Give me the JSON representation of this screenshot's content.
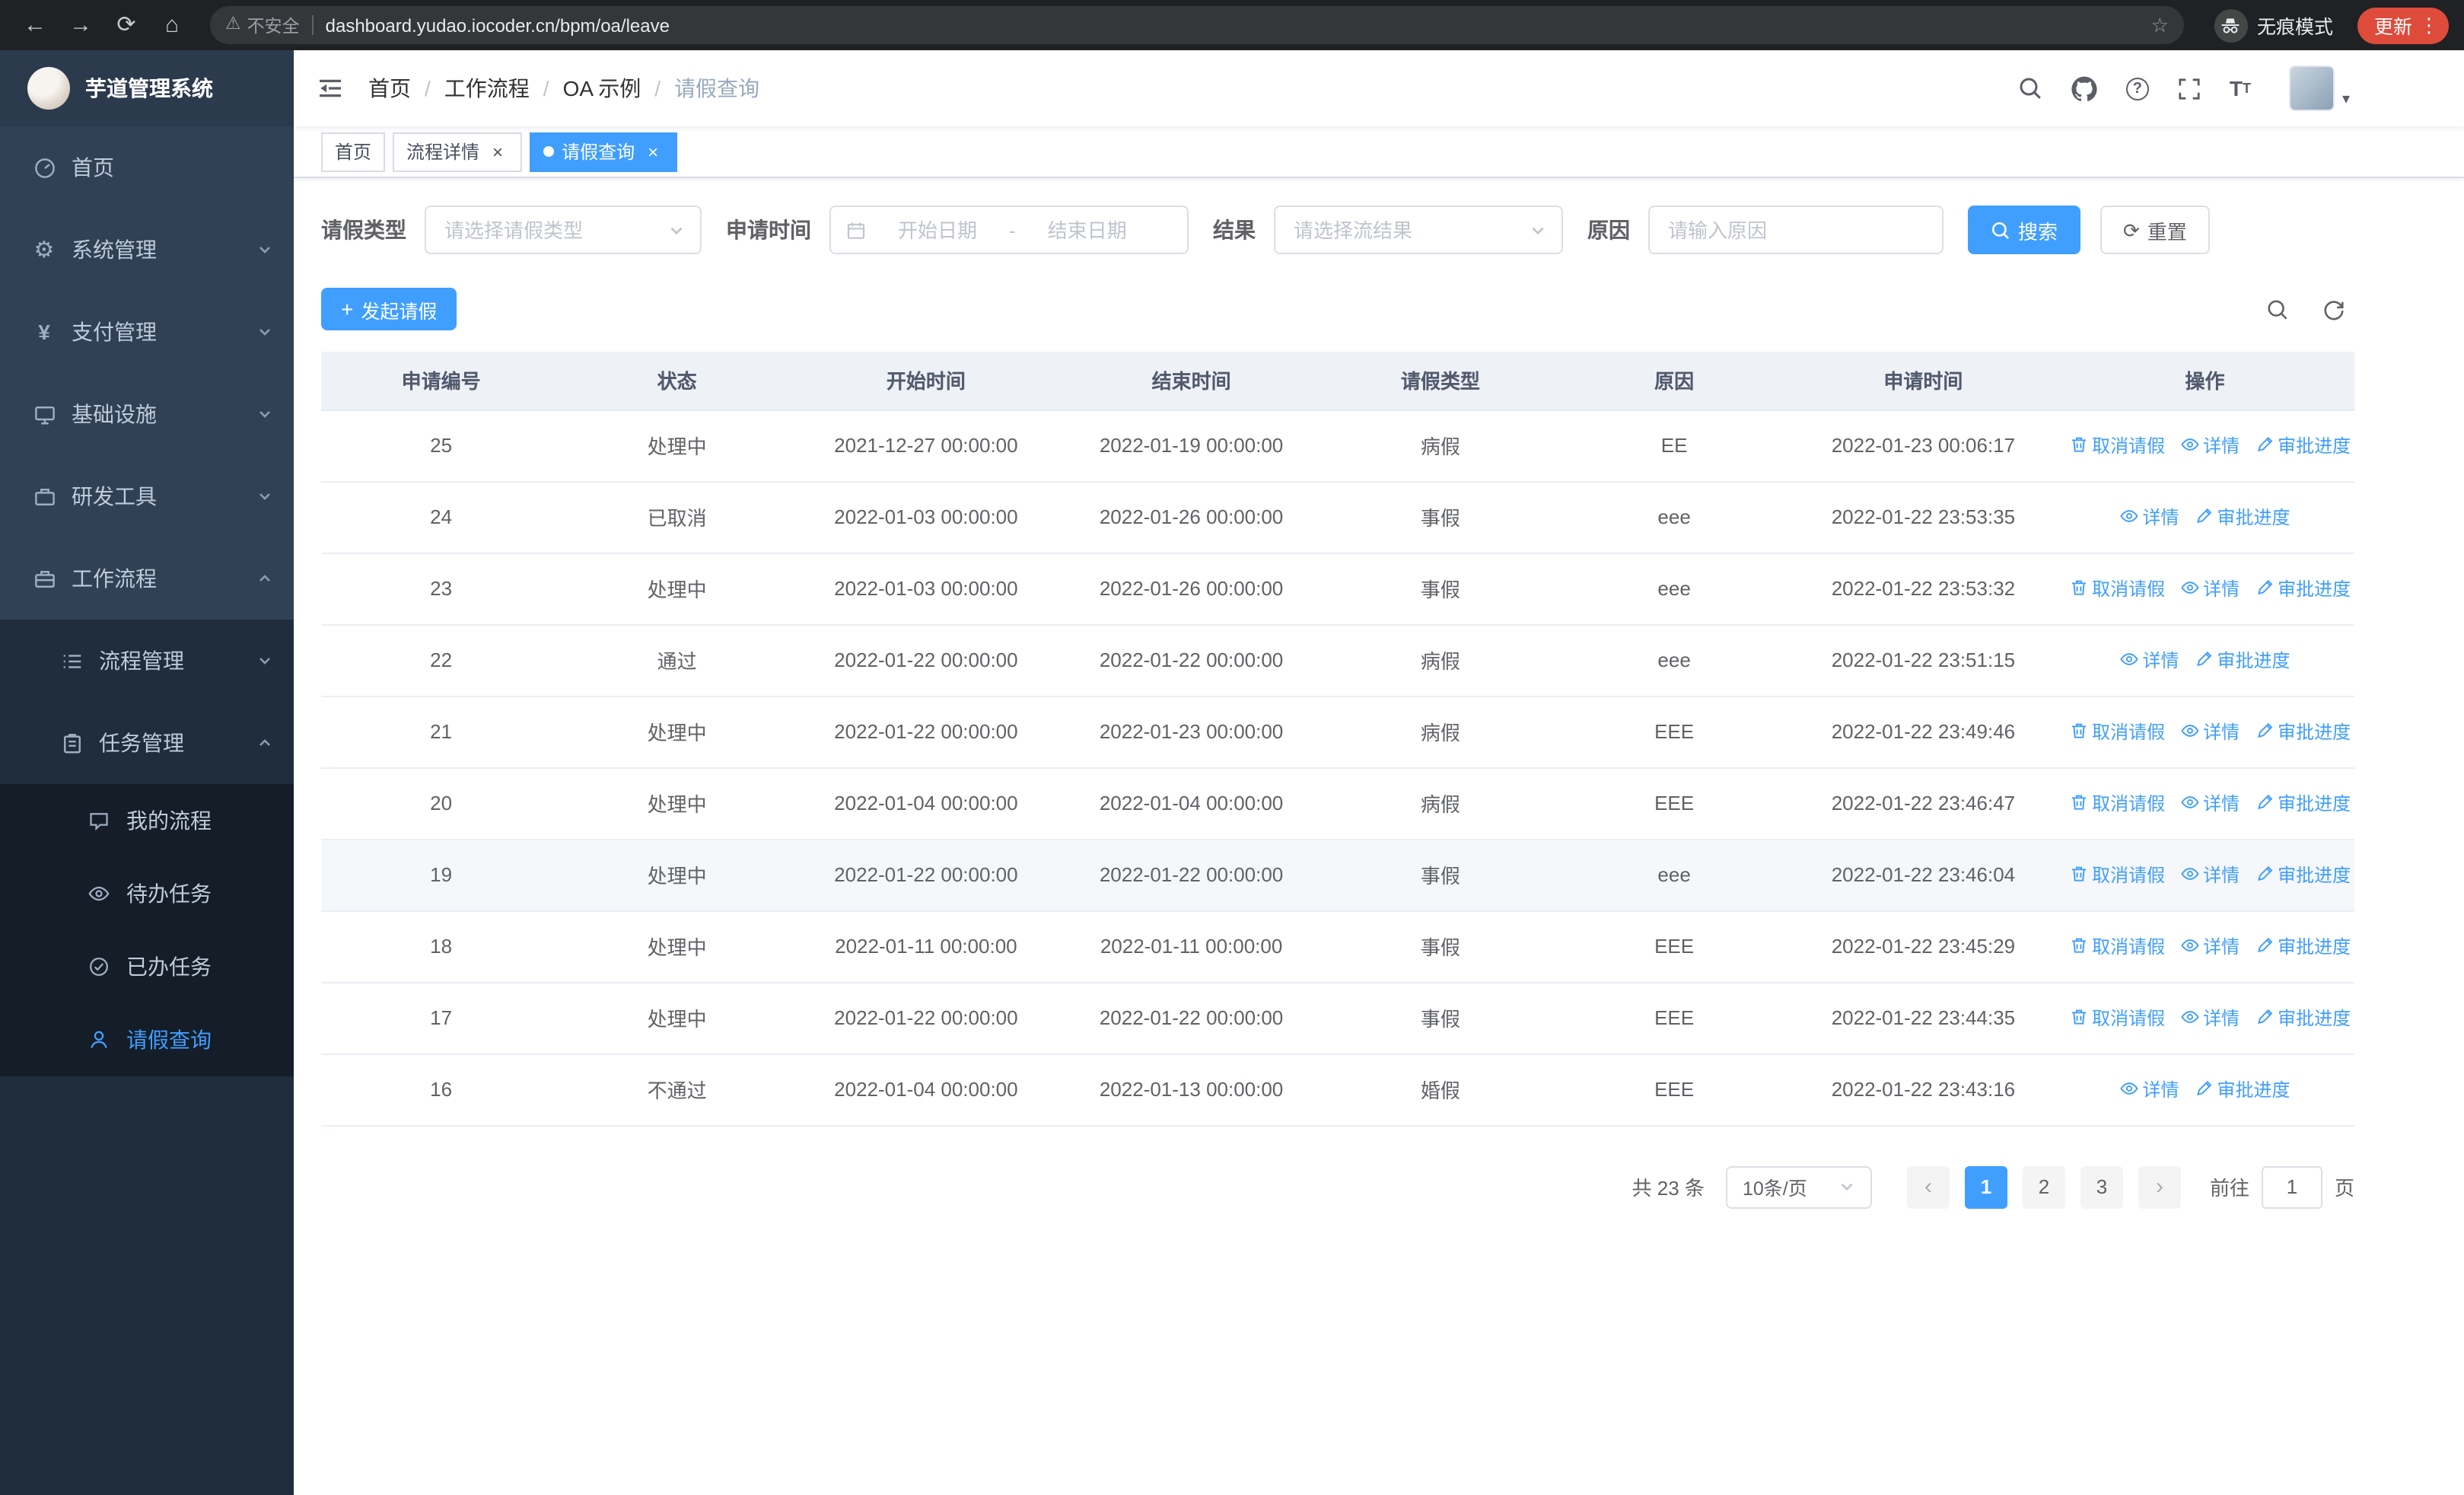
{
  "browser": {
    "security_label": "不安全",
    "url": "dashboard.yudao.iocoder.cn/bpm/oa/leave",
    "incognito_label": "无痕模式",
    "update_label": "更新"
  },
  "icons": {
    "back": "←",
    "forward": "→",
    "reload": "⟳",
    "home": "⌂",
    "warning": "⚠",
    "star": "☆",
    "dots": "⋮",
    "gear": "⚙",
    "yen": "¥",
    "question": "?",
    "plus": "+",
    "close": "×",
    "caret": "▾",
    "t_large": "T",
    "t_small": "T",
    "prev": "‹",
    "next": "›"
  },
  "sidebar": {
    "logo_title": "芋道管理系统",
    "menu": [
      {
        "label": "首页"
      },
      {
        "label": "系统管理"
      },
      {
        "label": "支付管理"
      },
      {
        "label": "基础设施"
      },
      {
        "label": "研发工具"
      },
      {
        "label": "工作流程"
      },
      {
        "label": "流程管理"
      },
      {
        "label": "任务管理"
      },
      {
        "label": "我的流程"
      },
      {
        "label": "待办任务"
      },
      {
        "label": "已办任务"
      },
      {
        "label": "请假查询"
      }
    ]
  },
  "header": {
    "breadcrumb": [
      "首页",
      "工作流程",
      "OA 示例",
      "请假查询"
    ]
  },
  "tabs": [
    {
      "label": "首页"
    },
    {
      "label": "流程详情"
    },
    {
      "label": "请假查询"
    }
  ],
  "filters": {
    "leave_type": {
      "label": "请假类型",
      "placeholder": "请选择请假类型"
    },
    "apply_time": {
      "label": "申请时间",
      "start_placeholder": "开始日期",
      "separator": "-",
      "end_placeholder": "结束日期"
    },
    "result": {
      "label": "结果",
      "placeholder": "请选择流结果"
    },
    "reason": {
      "label": "原因",
      "placeholder": "请输入原因"
    },
    "search_label": "搜索",
    "reset_label": "重置"
  },
  "toolbar": {
    "create_label": "发起请假"
  },
  "table": {
    "columns": [
      "申请编号",
      "状态",
      "开始时间",
      "结束时间",
      "请假类型",
      "原因",
      "申请时间",
      "操作"
    ],
    "op_labels": {
      "cancel": "取消请假",
      "detail": "详情",
      "progress": "审批进度"
    },
    "rows": [
      {
        "id": "25",
        "status": "处理中",
        "start": "2021-12-27 00:00:00",
        "end": "2022-01-19 00:00:00",
        "type": "病假",
        "reason": "EE",
        "apply_time": "2022-01-23 00:06:17",
        "ops": [
          "cancel",
          "detail",
          "progress"
        ],
        "highlighted": false
      },
      {
        "id": "24",
        "status": "已取消",
        "start": "2022-01-03 00:00:00",
        "end": "2022-01-26 00:00:00",
        "type": "事假",
        "reason": "eee",
        "apply_time": "2022-01-22 23:53:35",
        "ops": [
          "detail",
          "progress"
        ],
        "highlighted": false
      },
      {
        "id": "23",
        "status": "处理中",
        "start": "2022-01-03 00:00:00",
        "end": "2022-01-26 00:00:00",
        "type": "事假",
        "reason": "eee",
        "apply_time": "2022-01-22 23:53:32",
        "ops": [
          "cancel",
          "detail",
          "progress"
        ],
        "highlighted": false
      },
      {
        "id": "22",
        "status": "通过",
        "start": "2022-01-22 00:00:00",
        "end": "2022-01-22 00:00:00",
        "type": "病假",
        "reason": "eee",
        "apply_time": "2022-01-22 23:51:15",
        "ops": [
          "detail",
          "progress"
        ],
        "highlighted": false
      },
      {
        "id": "21",
        "status": "处理中",
        "start": "2022-01-22 00:00:00",
        "end": "2022-01-23 00:00:00",
        "type": "病假",
        "reason": "EEE",
        "apply_time": "2022-01-22 23:49:46",
        "ops": [
          "cancel",
          "detail",
          "progress"
        ],
        "highlighted": false
      },
      {
        "id": "20",
        "status": "处理中",
        "start": "2022-01-04 00:00:00",
        "end": "2022-01-04 00:00:00",
        "type": "病假",
        "reason": "EEE",
        "apply_time": "2022-01-22 23:46:47",
        "ops": [
          "cancel",
          "detail",
          "progress"
        ],
        "highlighted": false
      },
      {
        "id": "19",
        "status": "处理中",
        "start": "2022-01-22 00:00:00",
        "end": "2022-01-22 00:00:00",
        "type": "事假",
        "reason": "eee",
        "apply_time": "2022-01-22 23:46:04",
        "ops": [
          "cancel",
          "detail",
          "progress"
        ],
        "highlighted": true
      },
      {
        "id": "18",
        "status": "处理中",
        "start": "2022-01-11 00:00:00",
        "end": "2022-01-11 00:00:00",
        "type": "事假",
        "reason": "EEE",
        "apply_time": "2022-01-22 23:45:29",
        "ops": [
          "cancel",
          "detail",
          "progress"
        ],
        "highlighted": false
      },
      {
        "id": "17",
        "status": "处理中",
        "start": "2022-01-22 00:00:00",
        "end": "2022-01-22 00:00:00",
        "type": "事假",
        "reason": "EEE",
        "apply_time": "2022-01-22 23:44:35",
        "ops": [
          "cancel",
          "detail",
          "progress"
        ],
        "highlighted": false
      },
      {
        "id": "16",
        "status": "不通过",
        "start": "2022-01-04 00:00:00",
        "end": "2022-01-13 00:00:00",
        "type": "婚假",
        "reason": "EEE",
        "apply_time": "2022-01-22 23:43:16",
        "ops": [
          "detail",
          "progress"
        ],
        "highlighted": false
      }
    ]
  },
  "pagination": {
    "total_label": "共 23 条",
    "page_size_label": "10条/页",
    "pages": [
      "1",
      "2",
      "3"
    ],
    "active_page": "1",
    "goto_label": "前往",
    "goto_value": "1",
    "page_unit": "页"
  },
  "colors": {
    "primary": "#409eff",
    "sidebar_bg": "#304156",
    "sidebar_sub_bg": "#1f2d3d",
    "sidebar_deep_bg": "#141d28",
    "chrome_bg": "#202124",
    "update_pill": "#de4b3b",
    "table_header_bg": "#eef1f6"
  }
}
